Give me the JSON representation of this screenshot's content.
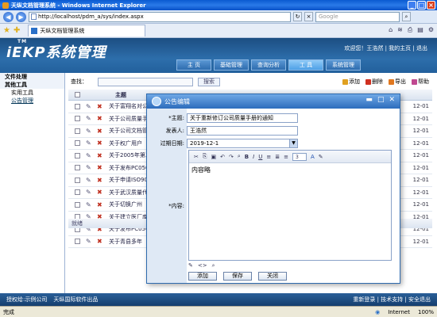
{
  "browser": {
    "title": "天纵文档管理系统 - Windows Internet Explorer",
    "url": "http://localhost/pdm_a/sys/index.aspx",
    "search_placeholder": "Google",
    "tab_title": "天纵文档管理系统"
  },
  "app": {
    "logo_small": "TM",
    "logo_text": "iEKP系统管理",
    "user_line": "欢迎您！王浩然 | 我的主页 | 退出",
    "nav_tabs": [
      "主 页",
      "基础管理",
      "查询分析",
      "工 具",
      "系统管理"
    ],
    "active_tab_index": 3
  },
  "sidebar": {
    "items": [
      {
        "label": "文件处理",
        "type": "header"
      },
      {
        "label": "其他工具",
        "type": "header"
      },
      {
        "label": "实用工具",
        "type": "sub"
      },
      {
        "label": "公告管理",
        "type": "current"
      }
    ]
  },
  "list": {
    "search_label": "查找：",
    "search_button": "搜索",
    "actions": [
      "添加",
      "删除",
      "导出",
      "帮助"
    ],
    "column_title": "主题",
    "rows": [
      {
        "title": "关于富翔名对公",
        "date": "12-01"
      },
      {
        "title": "关于公司质量手",
        "date": "12-01"
      },
      {
        "title": "关于公司文档管",
        "date": "12-01"
      },
      {
        "title": "关于权广用户",
        "date": "12-01"
      },
      {
        "title": "关于2005年第二",
        "date": "12-01"
      },
      {
        "title": "关于发布PC050",
        "date": "12-01"
      },
      {
        "title": "关于申请ISO900",
        "date": "12-01"
      },
      {
        "title": "关于武汉质量代",
        "date": "12-01"
      },
      {
        "title": "关于切换广州",
        "date": "12-01"
      },
      {
        "title": "关于建立医厂库",
        "date": "12-01"
      },
      {
        "title": "关于发布PC050",
        "date": "12-01"
      },
      {
        "title": "关于青县多年",
        "date": "12-01"
      }
    ],
    "footer_label": "就绪"
  },
  "modal": {
    "title": "公告编辑",
    "subject_label": "*主题:",
    "subject_value": "关于重新修订公司质量手册的通知",
    "publisher_label": "发表人:",
    "publisher_value": "王浩然",
    "expiry_label": "过期日期:",
    "expiry_value": "2019-12-1",
    "content_label": "*内容:",
    "content_value": "内容略",
    "font_size": "3",
    "buttons": [
      "添加",
      "保存",
      "关闭"
    ]
  },
  "footer": {
    "left1": "授权给:示例公司",
    "left2": "天纵国际软件出品",
    "right": "重新登录 | 技术支持 | 安全退出"
  },
  "statusbar": {
    "status": "完成",
    "zone": "Internet",
    "zoom": "100%"
  }
}
